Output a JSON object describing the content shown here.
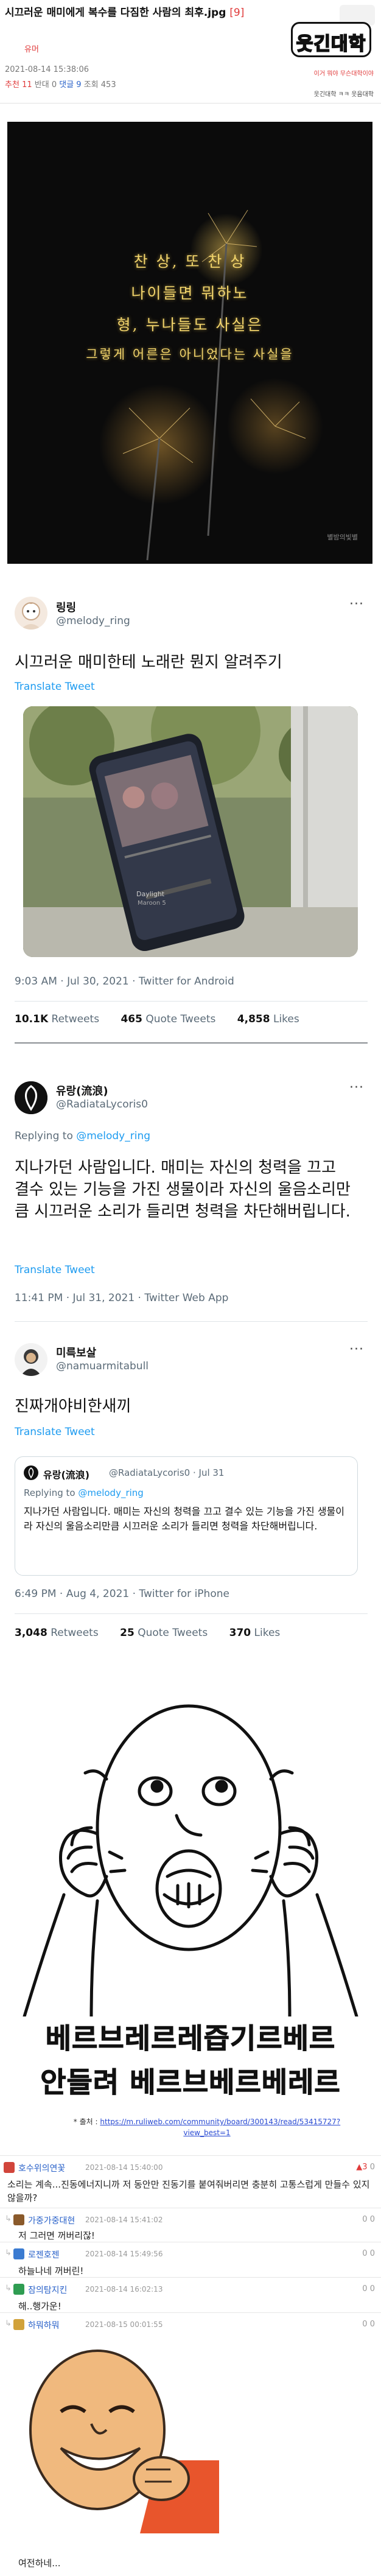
{
  "post": {
    "title": "시끄러운 매미에게 복수를 다짐한 사람의 최후.jpg",
    "title_tag": "[9]",
    "category": "유머",
    "date": "2021-08-14 15:38:06",
    "stats": {
      "recommend_label": "추천",
      "recommend": "11",
      "against_label": "반대",
      "against": "0",
      "comment_label": "댓글",
      "comment": "9",
      "views_label": "조회",
      "views": "453"
    }
  },
  "brand": {
    "logo_text": "웃긴대학",
    "line1": "이거 뭐야 무슨대학이야",
    "line2": "웃긴대학 ㅋㅋ 웃음대학"
  },
  "sparkler": {
    "lines": [
      "찬 상, 또 찬 상",
      "나이들면 뭐하노",
      "형, 누나들도 사실은",
      "그렇게 어른은 아니었다는 사실을"
    ],
    "signature": "별밤의빛별"
  },
  "tweet1": {
    "name": "링링",
    "handle": "@melody_ring",
    "more": "···",
    "text": "시끄러운 매미한테 노래란 뭔지 알려주기",
    "translate": "Translate Tweet",
    "meta": "9:03 AM · Jul 30, 2021 · Twitter for Android",
    "retweets": "10.1K",
    "retweets_label": "Retweets",
    "quotes": "465",
    "quotes_label": "Quote Tweets",
    "likes": "4,858",
    "likes_label": "Likes",
    "photo_song": "Daylight",
    "photo_artist": "Maroon 5"
  },
  "tweet2": {
    "name": "유랑(流浪)",
    "handle": "@RadiataLycoris0",
    "more": "···",
    "reply_prefix": "Replying to",
    "reply_to": "@melody_ring",
    "text": "지나가던 사람입니다. 매미는 자신의 청력을 끄고 결수 있는 기능을 가진 생물이라 자신의 울음소리만큼 시끄러운 소리가 들리면 청력을 차단해버립니다.",
    "translate": "Translate Tweet",
    "meta": "11:41 PM · Jul 31, 2021 · Twitter Web App"
  },
  "tweet3": {
    "name": "미륵보살",
    "handle": "@namuarmitabull",
    "more": "···",
    "text": "진짜개야비한새끼",
    "translate": "Translate Tweet",
    "quote_name": "유랑(流浪)",
    "quote_handle": "@RadiataLycoris0 · Jul 31",
    "quote_reply_prefix": "Replying to",
    "quote_reply_to": "@melody_ring",
    "quote_text": "지나가던 사람입니다. 매미는 자신의 청력을 끄고 결수 있는 기능을 가진 생물이라 자신의 울음소리만큼 시끄러운 소리가 들리면 청력을 차단해버립니다.",
    "meta": "6:49 PM · Aug 4, 2021 · Twitter for iPhone",
    "retweets": "3,048",
    "retweets_label": "Retweets",
    "quotes": "25",
    "quotes_label": "Quote Tweets",
    "likes": "370",
    "likes_label": "Likes"
  },
  "meme": {
    "caption1": "베르브레르레즙기르베르",
    "caption2": "안들려 베르브베르베레르"
  },
  "source": {
    "label": "* 출처 :",
    "url": "https://m.ruliweb.com/community/board/300143/read/53415727?view_best=1"
  },
  "comments": [
    {
      "nick": "호수위의연꽃",
      "date": "2021-08-14 15:40:00",
      "up": "3",
      "down": "0",
      "body": "소리는 계속...진동에너지니까 저 동안만 진동기를 붙여줘버리면 충분히 고통스럽게 만들수 있지 않을까?"
    },
    {
      "nick": "가중가중대현",
      "date": "2021-08-14 15:41:02",
      "up": "0",
      "down": "0",
      "body": "저 그러면 꺼버리잖!"
    },
    {
      "nick": "로젠호젠",
      "date": "2021-08-14 15:49:56",
      "up": "0",
      "down": "0",
      "body": "하늘나네 꺼버린!"
    },
    {
      "nick": "잠의탐지킨",
      "date": "2021-08-14 16:02:13",
      "up": "0",
      "down": "0",
      "body": "해..행가운!"
    },
    {
      "nick": "하뭐하뭐",
      "date": "2021-08-15 00:01:55",
      "up": "0",
      "down": "0",
      "body": "여전하네..."
    }
  ],
  "colors": {
    "accent_red": "#e03a3a",
    "link_blue": "#1d9bf0",
    "nick_blue": "#2a62c9",
    "sparkler_text": "#f0d36b"
  }
}
